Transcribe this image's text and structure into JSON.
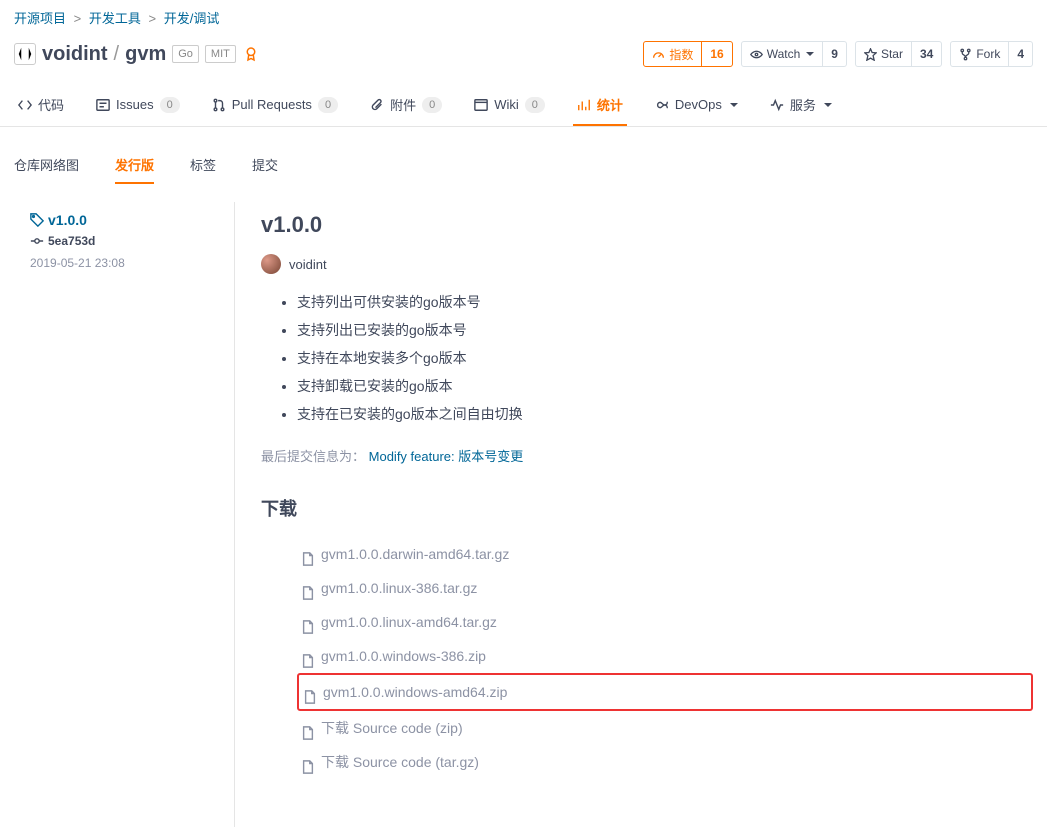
{
  "breadcrumb": {
    "a": "开源项目",
    "b": "开发工具",
    "c": "开发/调试"
  },
  "repo": {
    "owner": "voidint",
    "name": "gvm",
    "lang": "Go",
    "license": "MIT"
  },
  "socials": {
    "index": {
      "label": "指数",
      "count": "16"
    },
    "watch": {
      "label": "Watch",
      "count": "9"
    },
    "star": {
      "label": "Star",
      "count": "34"
    },
    "fork": {
      "label": "Fork",
      "count": "4"
    }
  },
  "tabs": {
    "code": "代码",
    "issues": "Issues",
    "issues_count": "0",
    "pulls": "Pull Requests",
    "pulls_count": "0",
    "attach": "附件",
    "attach_count": "0",
    "wiki": "Wiki",
    "wiki_count": "0",
    "stats": "统计",
    "devops": "DevOps",
    "service": "服务"
  },
  "subtabs": {
    "network": "仓库网络图",
    "releases": "发行版",
    "tags": "标签",
    "commits": "提交"
  },
  "sidebar": {
    "tag": "v1.0.0",
    "commit": "5ea753d",
    "date": "2019-05-21 23:08"
  },
  "release": {
    "title": "v1.0.0",
    "author": "voidint",
    "notes": [
      "支持列出可供安装的go版本号",
      "支持列出已安装的go版本号",
      "支持在本地安装多个go版本",
      "支持卸载已安装的go版本",
      "支持在已安装的go版本之间自由切换"
    ],
    "last_commit_label": "最后提交信息为：",
    "last_commit_msg": "Modify feature: 版本号变更",
    "downloads_heading": "下载",
    "downloads": [
      {
        "name": "gvm1.0.0.darwin-amd64.tar.gz"
      },
      {
        "name": "gvm1.0.0.linux-386.tar.gz"
      },
      {
        "name": "gvm1.0.0.linux-amd64.tar.gz"
      },
      {
        "name": "gvm1.0.0.windows-386.zip"
      },
      {
        "name": "gvm1.0.0.windows-amd64.zip",
        "highlight": true
      },
      {
        "name": "下载 Source code (zip)"
      },
      {
        "name": "下载 Source code (tar.gz)"
      }
    ]
  }
}
